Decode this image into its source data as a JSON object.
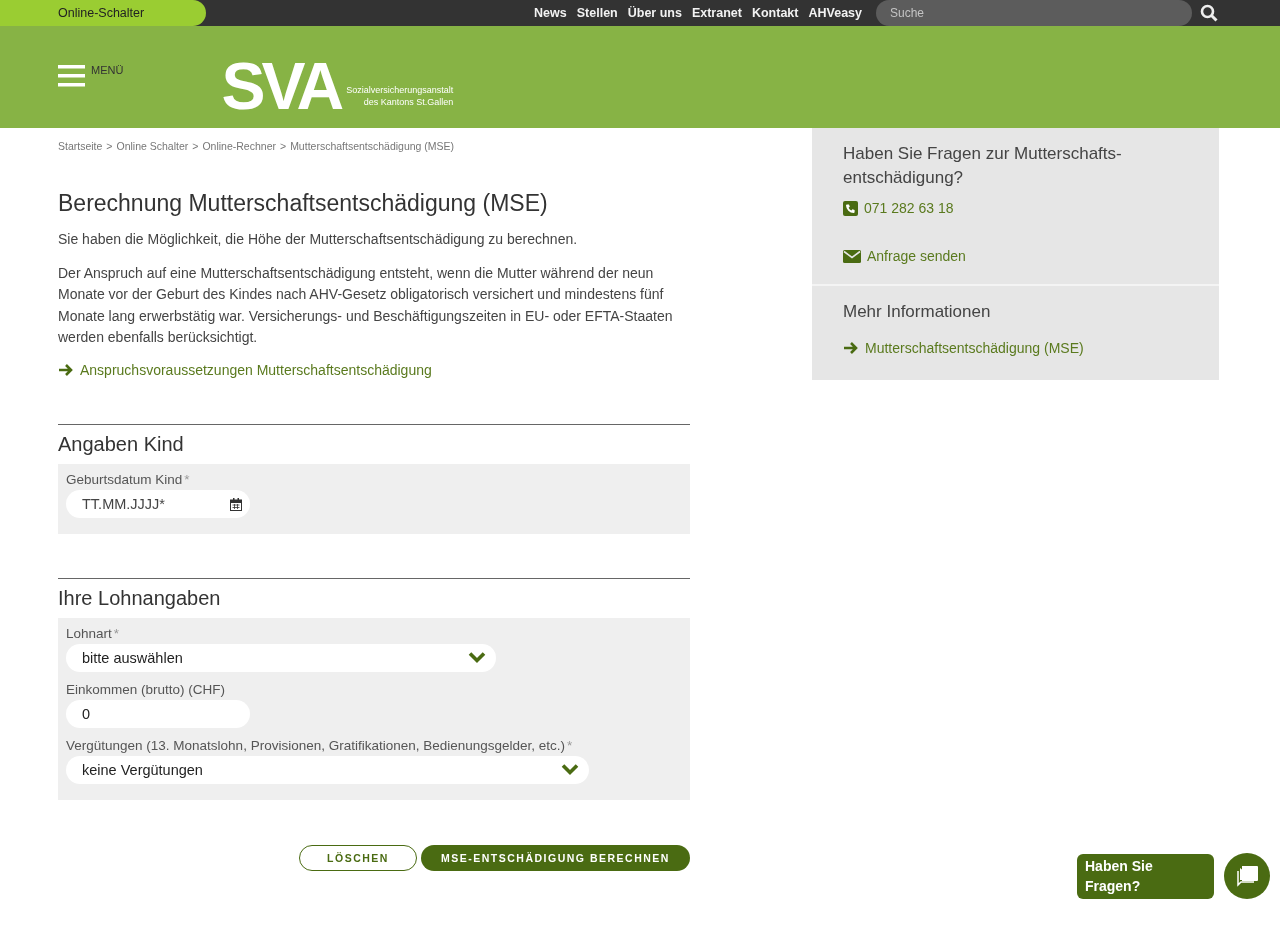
{
  "topbar": {
    "online_button": "Online-Schalter",
    "links": [
      "News",
      "Stellen",
      "Über uns",
      "Extranet",
      "Kontakt",
      "AHVeasy"
    ],
    "search": {
      "placeholder": "Suche"
    }
  },
  "header": {
    "menu_label": "MENÜ",
    "logo": "SVA",
    "logo_lines": [
      "Sozialversicherungsanstalt",
      "des Kantons St.Gallen"
    ]
  },
  "breadcrumb": {
    "separator": ">",
    "items": [
      "Startseite",
      "Online Schalter",
      "Online-Rechner",
      "Mutterschaftsentschädigung (MSE)"
    ]
  },
  "title": "Berechnung Mutterschaftsentschädigung (MSE)",
  "paragraphs": [
    "Sie haben die Möglichkeit, die Höhe der Mutterschaftsentschädigung zu berechnen.",
    "Der Anspruch auf eine Mutterschaftsentschädigung entsteht, wenn die Mutter während der neun Monate vor der Geburt des Kindes nach AHV-Gesetz obligatorisch versichert und mindestens fünf Monate lang erwerbstätig war. Versicherungs- und Beschäftigungszeiten in EU- oder EFTA-Staaten werden ebenfalls berücksichtigt."
  ],
  "intro_link": "Anspruchsvoraussetzungen Mutterschaftsentschädigung",
  "sections": [
    {
      "heading": "Angaben Kind",
      "fields": [
        {
          "kind": "date",
          "label": "Geburtsdatum Kind",
          "required_mark": "*",
          "placeholder": "TT.MM.JJJJ*"
        }
      ]
    },
    {
      "heading": "Ihre Lohnangaben",
      "fields": [
        {
          "kind": "select",
          "label": "Lohnart",
          "required_mark": "*",
          "value": "bitte auswählen"
        },
        {
          "kind": "text",
          "label": "Einkommen (brutto) (CHF)",
          "value": "0"
        },
        {
          "kind": "select",
          "label": "Vergütungen (13. Monatslohn, Provisionen, Gratifikationen, Bedienungsgelder, etc.)",
          "required_mark": "*",
          "value": "keine Vergütungen"
        }
      ]
    }
  ],
  "buttons": [
    {
      "kind": "secondary",
      "label": "LÖSCHEN"
    },
    {
      "kind": "primary",
      "label": "MSE-ENTSCHÄDIGUNG BERECHNEN"
    }
  ],
  "sidebar": {
    "contact": {
      "heading": "Haben Sie Fragen zur Mutterschafts-entschädigung?",
      "phone": "071 282 63 18",
      "mail": "Anfrage senden"
    },
    "more": {
      "heading": "Mehr Informationen",
      "links": [
        "Mutterschaftsentschädigung (MSE)"
      ]
    }
  },
  "chat": {
    "label": "Haben Sie Fragen?"
  }
}
